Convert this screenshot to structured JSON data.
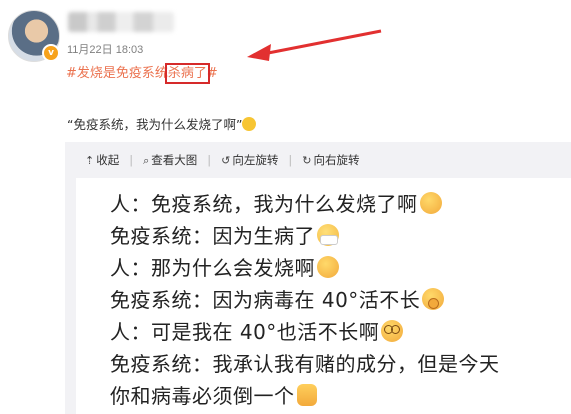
{
  "post": {
    "timestamp": "11月22日 18:03",
    "hashtag_before": "#发烧是免疫系统",
    "hashtag_highlight": "杀病了",
    "hashtag_after": "#",
    "quote_text": "“免疫系统，我为什么发烧了啊”",
    "highlight_color": "#d62a2a",
    "hashtag_color": "#eb7350"
  },
  "toolbar": {
    "items": [
      {
        "icon": "collapse-icon",
        "label": "收起"
      },
      {
        "icon": "zoom-icon",
        "label": "查看大图"
      },
      {
        "icon": "rotate-left-icon",
        "label": "向左旋转"
      },
      {
        "icon": "rotate-right-icon",
        "label": "向右旋转"
      }
    ]
  },
  "image_text": {
    "lines": [
      {
        "text": "人：免疫系统，我为什么发烧了啊",
        "emoji": "hot-face-emoji"
      },
      {
        "text": "免疫系统：因为生病了",
        "emoji": "mask-face-emoji"
      },
      {
        "text": "人：那为什么会发烧啊",
        "emoji": "hot-face-emoji"
      },
      {
        "text": "免疫系统：因为病毒在 40°活不长",
        "emoji": "yawn-face-emoji"
      },
      {
        "text": "人：可是我在 40°也活不长啊",
        "emoji": "dizzy-face-emoji"
      },
      {
        "text": "免疫系统：我承认我有赌的成分，但是今天",
        "emoji": ""
      },
      {
        "text": "你和病毒必须倒一个",
        "emoji": "fist-emoji"
      }
    ]
  }
}
